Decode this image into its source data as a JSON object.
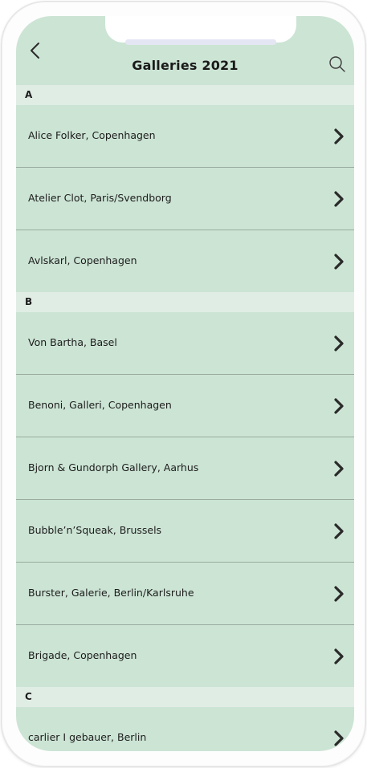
{
  "header": {
    "title": "Galleries 2021",
    "back_icon": "chevron-left-icon",
    "search_icon": "search-icon"
  },
  "sections": [
    {
      "letter": "A",
      "items": [
        {
          "label": "Alice Folker, Copenhagen"
        },
        {
          "label": "Atelier Clot, Paris/Svendborg"
        },
        {
          "label": "Avlskarl, Copenhagen"
        }
      ]
    },
    {
      "letter": "B",
      "items": [
        {
          "label": "Von Bartha, Basel"
        },
        {
          "label": "Benoni, Galleri, Copenhagen"
        },
        {
          "label": "Bjorn & Gundorph Gallery, Aarhus"
        },
        {
          "label": "Bubble’n’Squeak, Brussels"
        },
        {
          "label": "Burster, Galerie, Berlin/Karlsruhe"
        },
        {
          "label": "Brigade, Copenhagen"
        }
      ]
    },
    {
      "letter": "C",
      "items": [
        {
          "label": "carlier I gebauer, Berlin"
        }
      ]
    }
  ],
  "colors": {
    "background": "#cce4d4",
    "section_header": "#e0ede5",
    "divider": "#98ab9e",
    "text": "#1c1c1c",
    "chevron": "#2a2a2a"
  }
}
